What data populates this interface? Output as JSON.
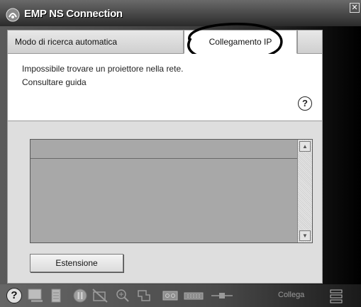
{
  "window": {
    "title": "EMP NS Connection",
    "close_glyph": "✕"
  },
  "tabs": {
    "auto_search": "Modo di ricerca automatica",
    "ip_connect": "Collegamento IP"
  },
  "message": {
    "line1": "Impossibile trovare un proiettore nella rete.",
    "line2": "Consultare guida",
    "help_glyph": "?"
  },
  "list": {
    "scroll_up": "▲",
    "scroll_down": "▼"
  },
  "buttons": {
    "extension": "Estensione"
  },
  "toolbar": {
    "help_glyph": "?",
    "connect_label": "Collega",
    "icons": [
      "help-icon",
      "display-icon",
      "document-icon",
      "pause-icon",
      "no-image-icon",
      "zoom-icon",
      "tool-icon",
      "tape-icon",
      "keyboard-icon",
      "connector-icon",
      "menu-icon"
    ]
  },
  "colors": {
    "highlight_ellipse": "#000000",
    "dim_icon": "#9a9a9a"
  }
}
